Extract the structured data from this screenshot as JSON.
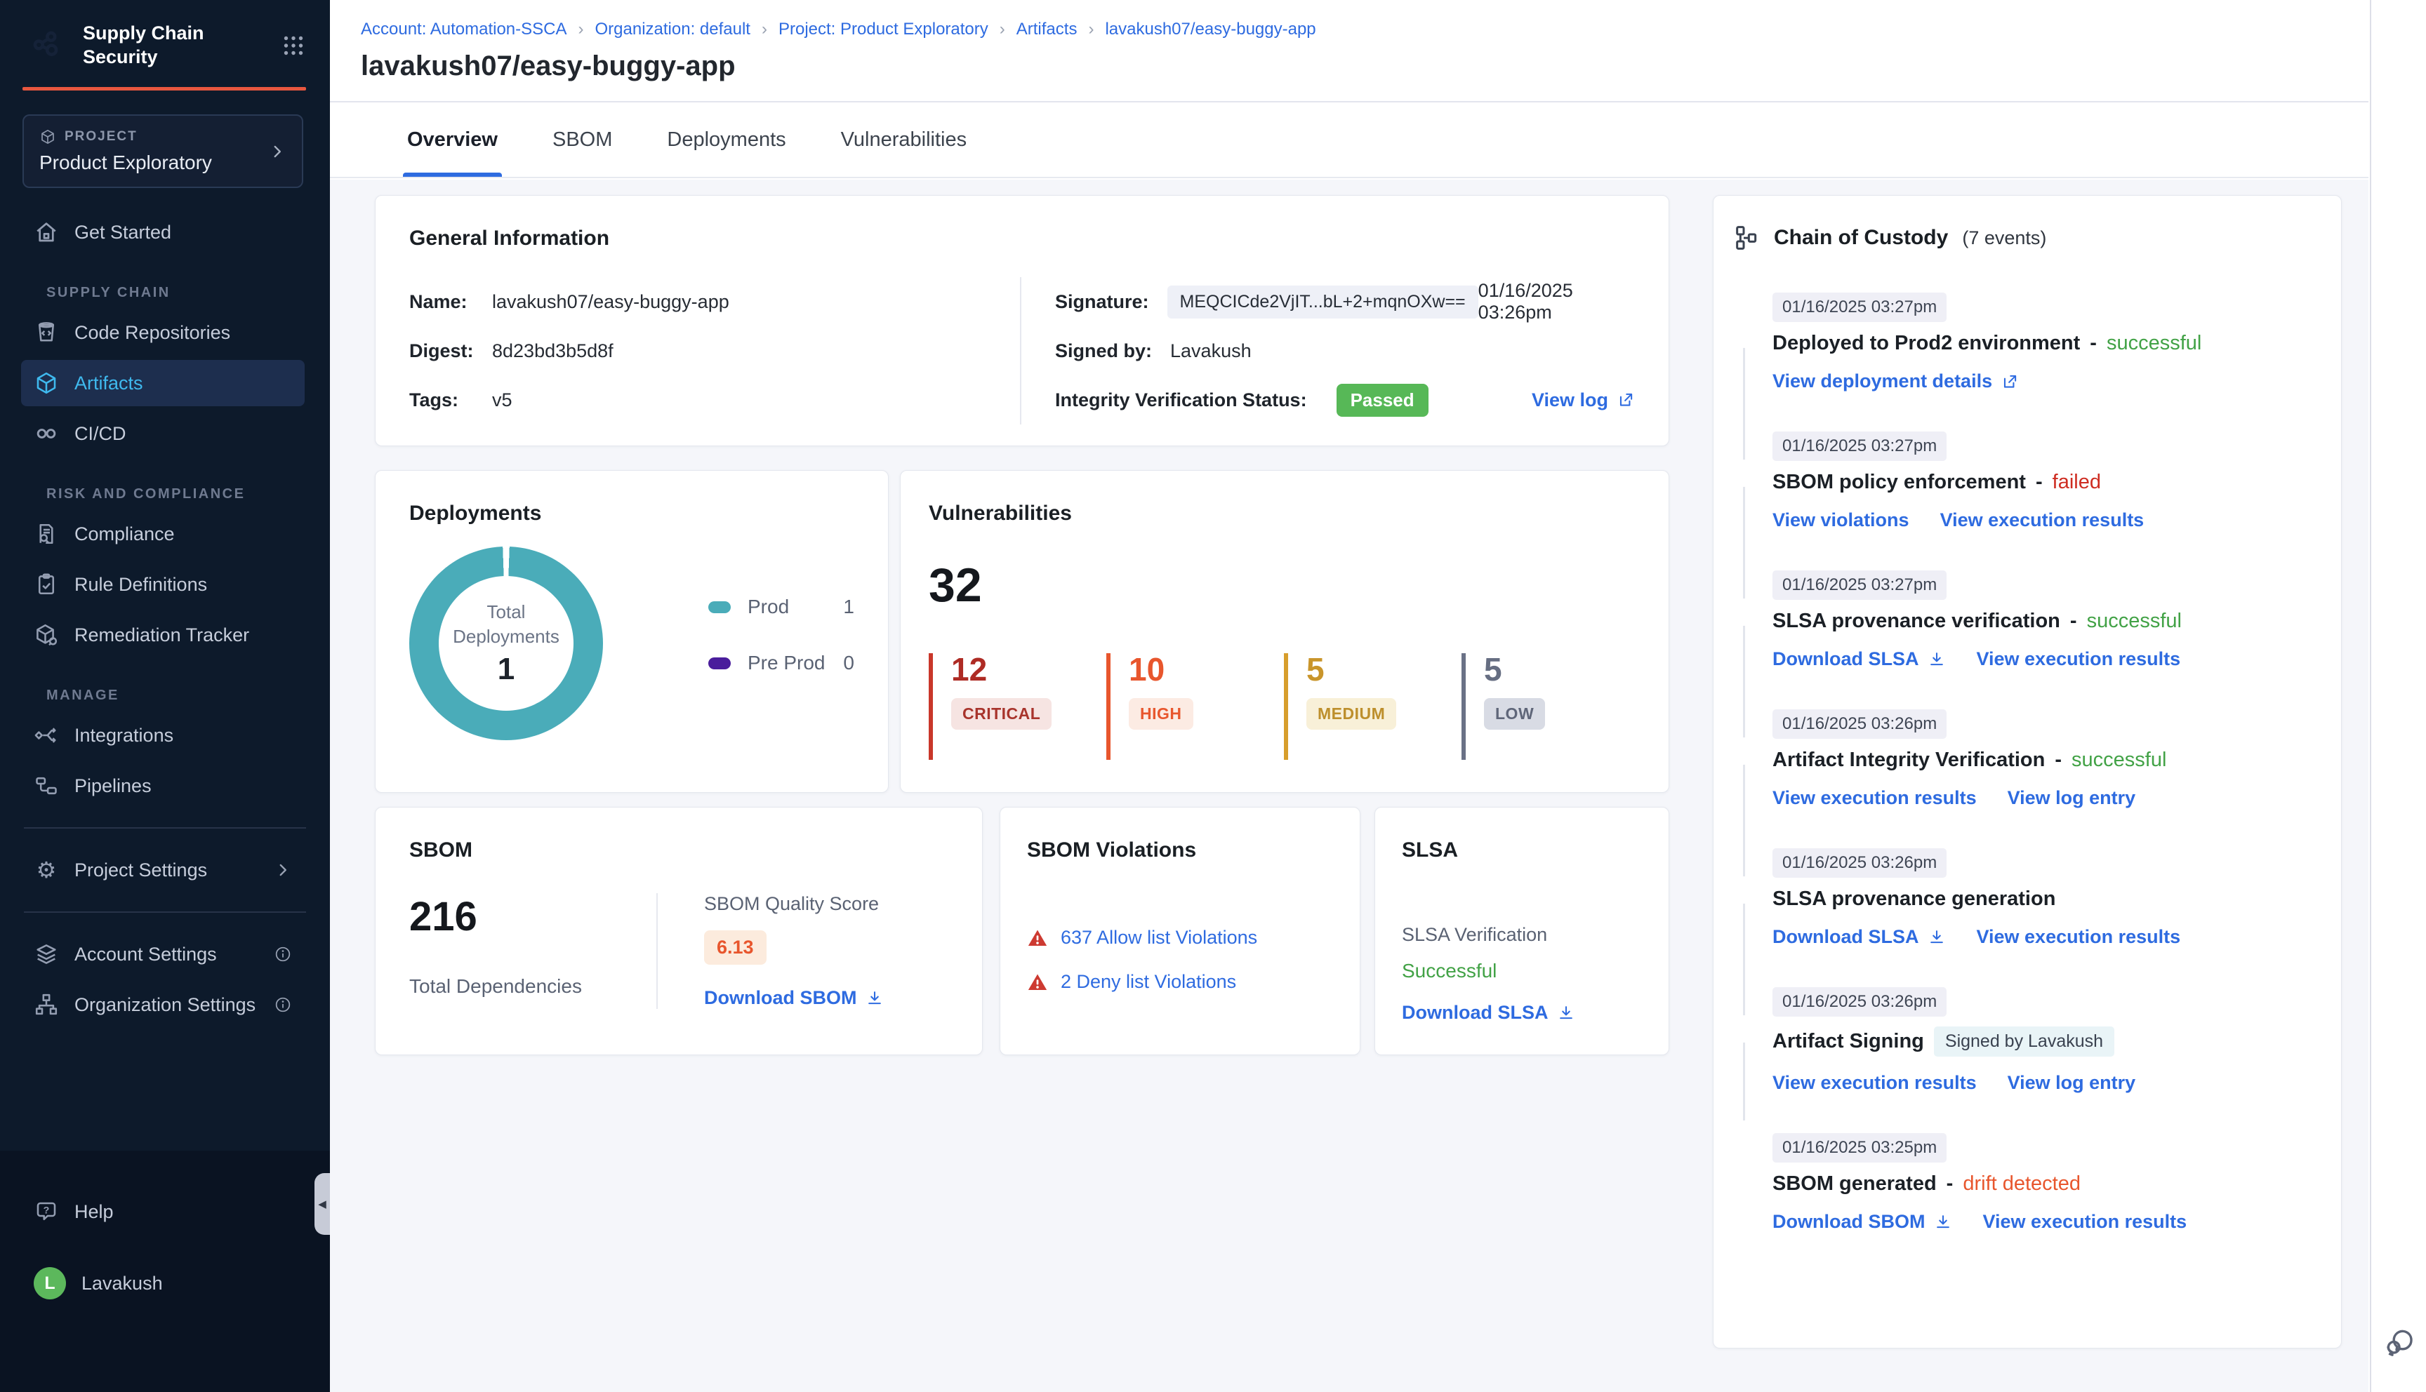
{
  "sidebar": {
    "app_title": "Supply Chain Security",
    "project_label": "PROJECT",
    "project_name": "Product Exploratory",
    "nav": {
      "get_started": "Get Started",
      "section_supply_chain": "SUPPLY CHAIN",
      "code_repositories": "Code Repositories",
      "artifacts": "Artifacts",
      "cicd": "CI/CD",
      "section_risk": "RISK AND COMPLIANCE",
      "compliance": "Compliance",
      "rule_definitions": "Rule Definitions",
      "remediation_tracker": "Remediation Tracker",
      "section_manage": "MANAGE",
      "integrations": "Integrations",
      "pipelines": "Pipelines",
      "project_settings": "Project Settings",
      "account_settings": "Account Settings",
      "organization_settings": "Organization Settings"
    },
    "help": "Help",
    "user_name": "Lavakush",
    "avatar_initial": "L"
  },
  "header": {
    "breadcrumb": [
      "Account: Automation-SSCA",
      "Organization: default",
      "Project: Product Exploratory",
      "Artifacts",
      "lavakush07/easy-buggy-app"
    ],
    "title": "lavakush07/easy-buggy-app"
  },
  "tabs": {
    "overview": "Overview",
    "sbom": "SBOM",
    "deployments": "Deployments",
    "vulnerabilities": "Vulnerabilities"
  },
  "general_info": {
    "title": "General Information",
    "name_label": "Name:",
    "name": "lavakush07/easy-buggy-app",
    "digest_label": "Digest:",
    "digest": "8d23bd3b5d8f",
    "tags_label": "Tags:",
    "tags": "v5",
    "signature_label": "Signature:",
    "signature": "MEQCICde2VjIT...bL+2+mqnOXw==",
    "signature_date": "01/16/2025 03:26pm",
    "signed_by_label": "Signed by:",
    "signed_by": "Lavakush",
    "integrity_label": "Integrity Verification Status:",
    "integrity_status": "Passed",
    "view_log": "View log"
  },
  "deployments": {
    "title": "Deployments",
    "center_line1": "Total",
    "center_line2": "Deployments",
    "total": "1",
    "legend": [
      {
        "label": "Prod",
        "value": "1",
        "color": "#4AACB9"
      },
      {
        "label": "Pre Prod",
        "value": "0",
        "color": "#4A1D9C"
      }
    ]
  },
  "vulnerabilities": {
    "title": "Vulnerabilities",
    "total": "32",
    "severities": [
      {
        "count": "12",
        "label": "CRITICAL",
        "color": "#AE2B24"
      },
      {
        "count": "10",
        "label": "HIGH",
        "color": "#E8562D"
      },
      {
        "count": "5",
        "label": "MEDIUM",
        "color": "#C9952B"
      },
      {
        "count": "5",
        "label": "LOW",
        "color": "#6A7186"
      }
    ]
  },
  "sbom": {
    "title": "SBOM",
    "total": "216",
    "total_label": "Total Dependencies",
    "quality_label": "SBOM Quality Score",
    "quality_score": "6.13",
    "download_label": "Download SBOM"
  },
  "sbom_violations": {
    "title": "SBOM Violations",
    "allow": "637 Allow list Violations",
    "deny": "2 Deny list Violations"
  },
  "slsa": {
    "title": "SLSA",
    "verification_label": "SLSA Verification",
    "status": "Successful",
    "download_label": "Download SLSA"
  },
  "chain_of_custody": {
    "title": "Chain of Custody",
    "count": "(7 events)",
    "events": [
      {
        "timestamp": "01/16/2025 03:27pm",
        "title": "Deployed to Prod2 environment",
        "separator": "-",
        "status": "successful",
        "links": {
          "a": "View deployment details"
        }
      },
      {
        "timestamp": "01/16/2025 03:27pm",
        "title": "SBOM policy enforcement",
        "separator": "-",
        "status": "failed",
        "links": {
          "a": "View violations",
          "b": "View execution results"
        }
      },
      {
        "timestamp": "01/16/2025 03:27pm",
        "title": "SLSA provenance verification",
        "separator": "-",
        "status": "successful",
        "links": {
          "a": "Download SLSA",
          "b": "View execution results"
        }
      },
      {
        "timestamp": "01/16/2025 03:26pm",
        "title": "Artifact Integrity Verification",
        "separator": "-",
        "status": "successful",
        "links": {
          "a": "View execution results",
          "b": "View log entry"
        }
      },
      {
        "timestamp": "01/16/2025 03:26pm",
        "title": "SLSA provenance generation",
        "links": {
          "a": "Download SLSA",
          "b": "View execution results"
        }
      },
      {
        "timestamp": "01/16/2025 03:26pm",
        "title": "Artifact Signing",
        "badge": "Signed by Lavakush",
        "links": {
          "a": "View execution results",
          "b": "View log entry"
        }
      },
      {
        "timestamp": "01/16/2025 03:25pm",
        "title": "SBOM generated",
        "separator": "-",
        "status": "drift detected",
        "links": {
          "a": "Download SBOM",
          "b": "View execution results"
        }
      }
    ]
  },
  "colors": {
    "accent_orange": "#E8573F",
    "link_blue": "#2E6BE0",
    "success_green": "#42A246",
    "fail_red": "#CE2C21",
    "drift_orange": "#E8562D",
    "teal_donut": "#4AACB9",
    "preprod_purple": "#4A1D9C",
    "passed_badge_green": "#57B857",
    "sidebar_bg": "#0D1A2B",
    "active_nav_blue": "#3FB9EE"
  }
}
